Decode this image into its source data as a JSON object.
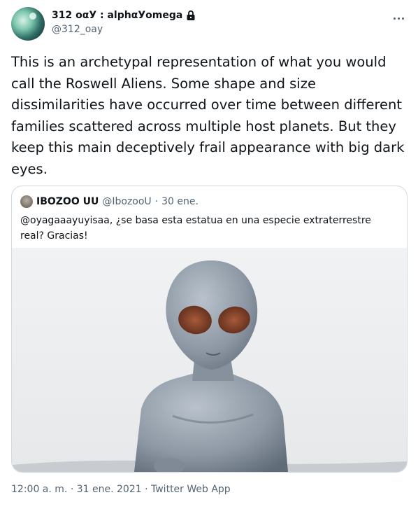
{
  "author": {
    "display_name": "312 οαУ : alphαУomega",
    "handle": "@312_oay"
  },
  "tweet": {
    "text": "This is an archetypal representation of what you would call the Roswell Aliens. Some shape and size dissimilarities have occurred over time between different families scattered across multiple host planets. But they keep this main deceptively frail appearance with big dark eyes."
  },
  "quoted_tweet": {
    "display_name": "IBOZOO UU",
    "handle": "@IbozooU",
    "separator": "·",
    "date": "30 ene.",
    "text": "@oyagaaayuyisaa, ¿se basa esta estatua en una especie extraterrestre real? Gracias!",
    "media_description_icon": "alien-statue-photo"
  },
  "meta": {
    "time": "12:00 a. m.",
    "separator1": "·",
    "date": "31 ene. 2021",
    "separator2": "·",
    "source": "Twitter Web App"
  },
  "icons": {
    "lock": "lock-icon",
    "more": "more-icon"
  },
  "colors": {
    "text": "#0f1419",
    "secondary": "#536471",
    "border": "#cfd9de"
  }
}
